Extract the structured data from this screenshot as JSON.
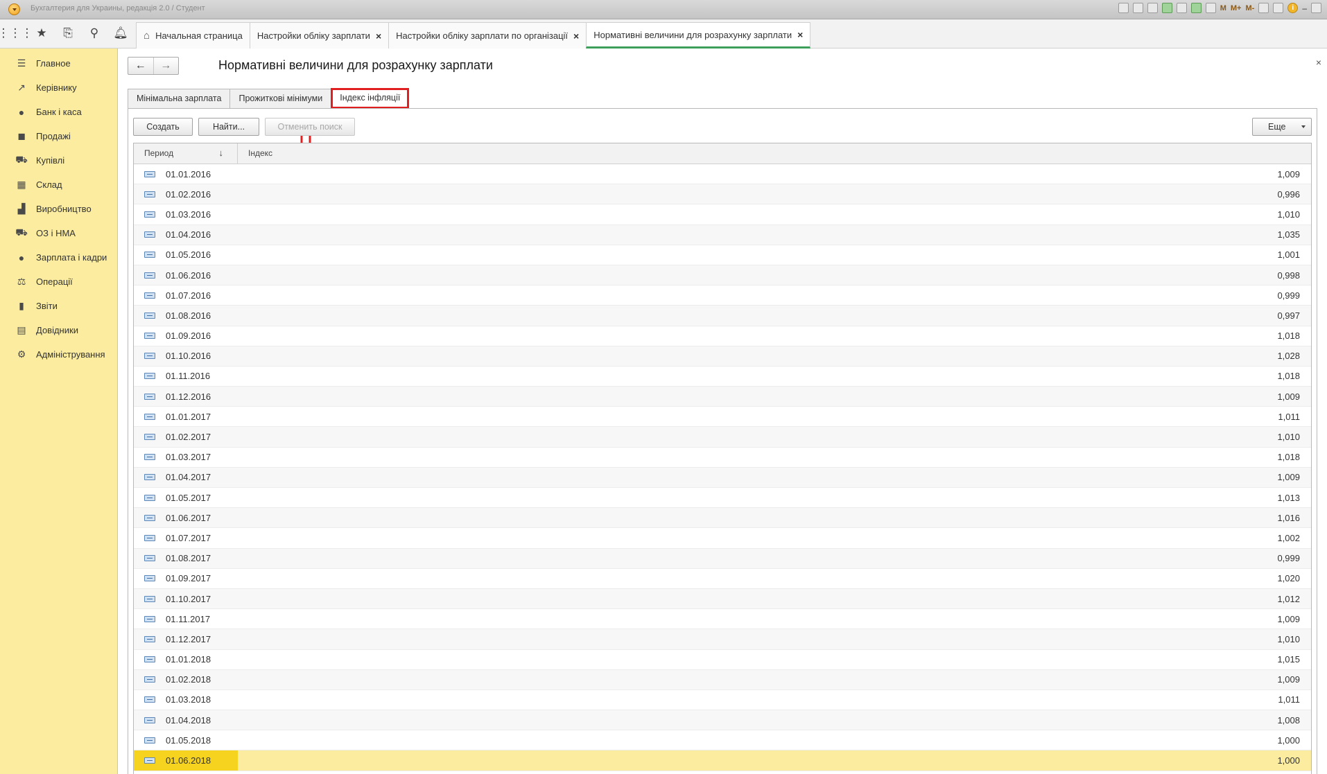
{
  "window": {
    "title": "Бухгалтерия для Украины, редакція 2.0 / Студент",
    "toolbar_labels": [
      "M",
      "M+",
      "M-"
    ]
  },
  "tabs": [
    {
      "label": "Начальная страница",
      "closable": false
    },
    {
      "label": "Настройки обліку зарплати",
      "closable": true
    },
    {
      "label": "Настройки обліку зарплати по організації",
      "closable": true
    },
    {
      "label": "Нормативні величини для розрахунку зарплати",
      "closable": true
    }
  ],
  "sidebar": {
    "items": [
      {
        "label": "Главное",
        "icon": "menu-lines-icon"
      },
      {
        "label": "Керівнику",
        "icon": "trend-icon"
      },
      {
        "label": "Банк і каса",
        "icon": "coin-icon"
      },
      {
        "label": "Продажі",
        "icon": "bag-icon"
      },
      {
        "label": "Купівлі",
        "icon": "cart-icon"
      },
      {
        "label": "Склад",
        "icon": "grid-icon"
      },
      {
        "label": "Виробництво",
        "icon": "factory-icon"
      },
      {
        "label": "ОЗ і НМА",
        "icon": "truck-icon"
      },
      {
        "label": "Зарплата і кадри",
        "icon": "person-icon"
      },
      {
        "label": "Операції",
        "icon": "operations-icon"
      },
      {
        "label": "Звіти",
        "icon": "bar-chart-icon"
      },
      {
        "label": "Довідники",
        "icon": "books-icon"
      },
      {
        "label": "Адміністрування",
        "icon": "gear-icon"
      }
    ]
  },
  "form": {
    "title": "Нормативні величини для розрахунку зарплати",
    "tabs": [
      "Мінімальна зарплата",
      "Прожиткові мінімуми",
      "Індекс інфляції"
    ],
    "active_tab": "Індекс інфляції",
    "buttons": {
      "create": "Создать",
      "find": "Найти...",
      "cancel_search": "Отменить поиск",
      "more": "Еще"
    },
    "columns": {
      "period": "Период",
      "index": "Індекс",
      "sort_glyph": "↓"
    }
  },
  "table": {
    "rows": [
      {
        "period": "01.01.2016",
        "index": "1,009"
      },
      {
        "period": "01.02.2016",
        "index": "0,996"
      },
      {
        "period": "01.03.2016",
        "index": "1,010"
      },
      {
        "period": "01.04.2016",
        "index": "1,035"
      },
      {
        "period": "01.05.2016",
        "index": "1,001"
      },
      {
        "period": "01.06.2016",
        "index": "0,998"
      },
      {
        "period": "01.07.2016",
        "index": "0,999"
      },
      {
        "period": "01.08.2016",
        "index": "0,997"
      },
      {
        "period": "01.09.2016",
        "index": "1,018"
      },
      {
        "period": "01.10.2016",
        "index": "1,028"
      },
      {
        "period": "01.11.2016",
        "index": "1,018"
      },
      {
        "period": "01.12.2016",
        "index": "1,009"
      },
      {
        "period": "01.01.2017",
        "index": "1,011"
      },
      {
        "period": "01.02.2017",
        "index": "1,010"
      },
      {
        "period": "01.03.2017",
        "index": "1,018"
      },
      {
        "period": "01.04.2017",
        "index": "1,009"
      },
      {
        "period": "01.05.2017",
        "index": "1,013"
      },
      {
        "period": "01.06.2017",
        "index": "1,016"
      },
      {
        "period": "01.07.2017",
        "index": "1,002"
      },
      {
        "period": "01.08.2017",
        "index": "0,999"
      },
      {
        "period": "01.09.2017",
        "index": "1,020"
      },
      {
        "period": "01.10.2017",
        "index": "1,012"
      },
      {
        "period": "01.11.2017",
        "index": "1,009"
      },
      {
        "period": "01.12.2017",
        "index": "1,010"
      },
      {
        "period": "01.01.2018",
        "index": "1,015"
      },
      {
        "period": "01.02.2018",
        "index": "1,009"
      },
      {
        "period": "01.03.2018",
        "index": "1,011"
      },
      {
        "period": "01.04.2018",
        "index": "1,008"
      },
      {
        "period": "01.05.2018",
        "index": "1,000"
      },
      {
        "period": "01.06.2018",
        "index": "1,000",
        "selected": true
      }
    ]
  },
  "colors": {
    "sidebar_bg": "#fbec9f",
    "selected_row": "#fbec9f",
    "selected_cell": "#f5d31f",
    "active_tab_underline": "#3ca05a",
    "highlight_red": "#e02020"
  }
}
